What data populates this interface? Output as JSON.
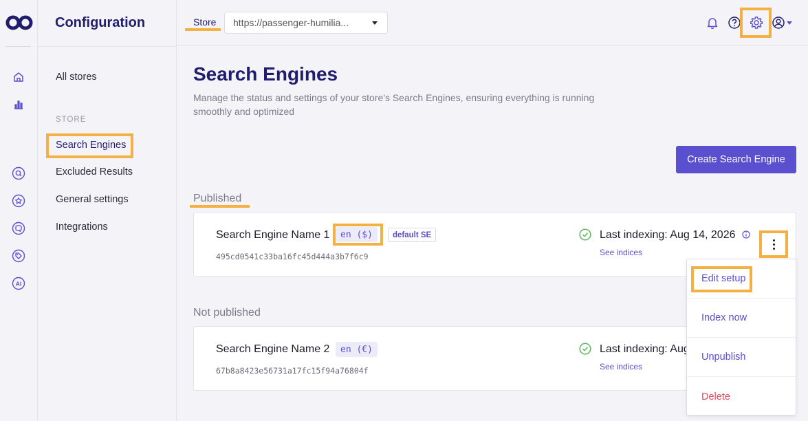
{
  "rail": {
    "icons": [
      "home-icon",
      "analytics-icon",
      "search-icon",
      "star-icon",
      "chat-icon",
      "tag-icon",
      "ai-icon"
    ],
    "ai_label": "AI"
  },
  "sidebar": {
    "title": "Configuration",
    "all_stores": "All stores",
    "section": "STORE",
    "items": [
      {
        "label": "Search Engines",
        "active": true
      },
      {
        "label": "Excluded Results"
      },
      {
        "label": "General settings"
      },
      {
        "label": "Integrations"
      }
    ]
  },
  "topbar": {
    "store_label": "Store",
    "store_url": "https://passenger-humilia..."
  },
  "page": {
    "title": "Search Engines",
    "description": "Manage the status and settings of your store's Search Engines, ensuring everything is running smoothly and optimized",
    "create_button": "Create Search Engine",
    "published_label": "Published",
    "not_published_label": "Not published"
  },
  "engines": [
    {
      "name": "Search Engine Name 1",
      "lang": "en ($)",
      "default_badge": "default SE",
      "id": "495cd0541c33ba16fc45d444a3b7f6c9",
      "indexing_label": "Last indexing:",
      "indexing_date": "Aug 14, 2026",
      "see_indices": "See indices"
    },
    {
      "name": "Search Engine Name 2",
      "lang": "en (€)",
      "id": "67b8a8423e56731a17fc15f94a76804f",
      "indexing_label": "Last indexing:",
      "indexing_date": "Aug",
      "see_indices": "See indices"
    }
  ],
  "menu": {
    "items": [
      "Edit setup",
      "Index now",
      "Unpublish",
      "Delete"
    ]
  },
  "colors": {
    "brand": "#201d6e",
    "accent": "#5a4fcf",
    "highlight": "#f5b043",
    "danger": "#e04a5a",
    "success": "#5cb85c"
  }
}
